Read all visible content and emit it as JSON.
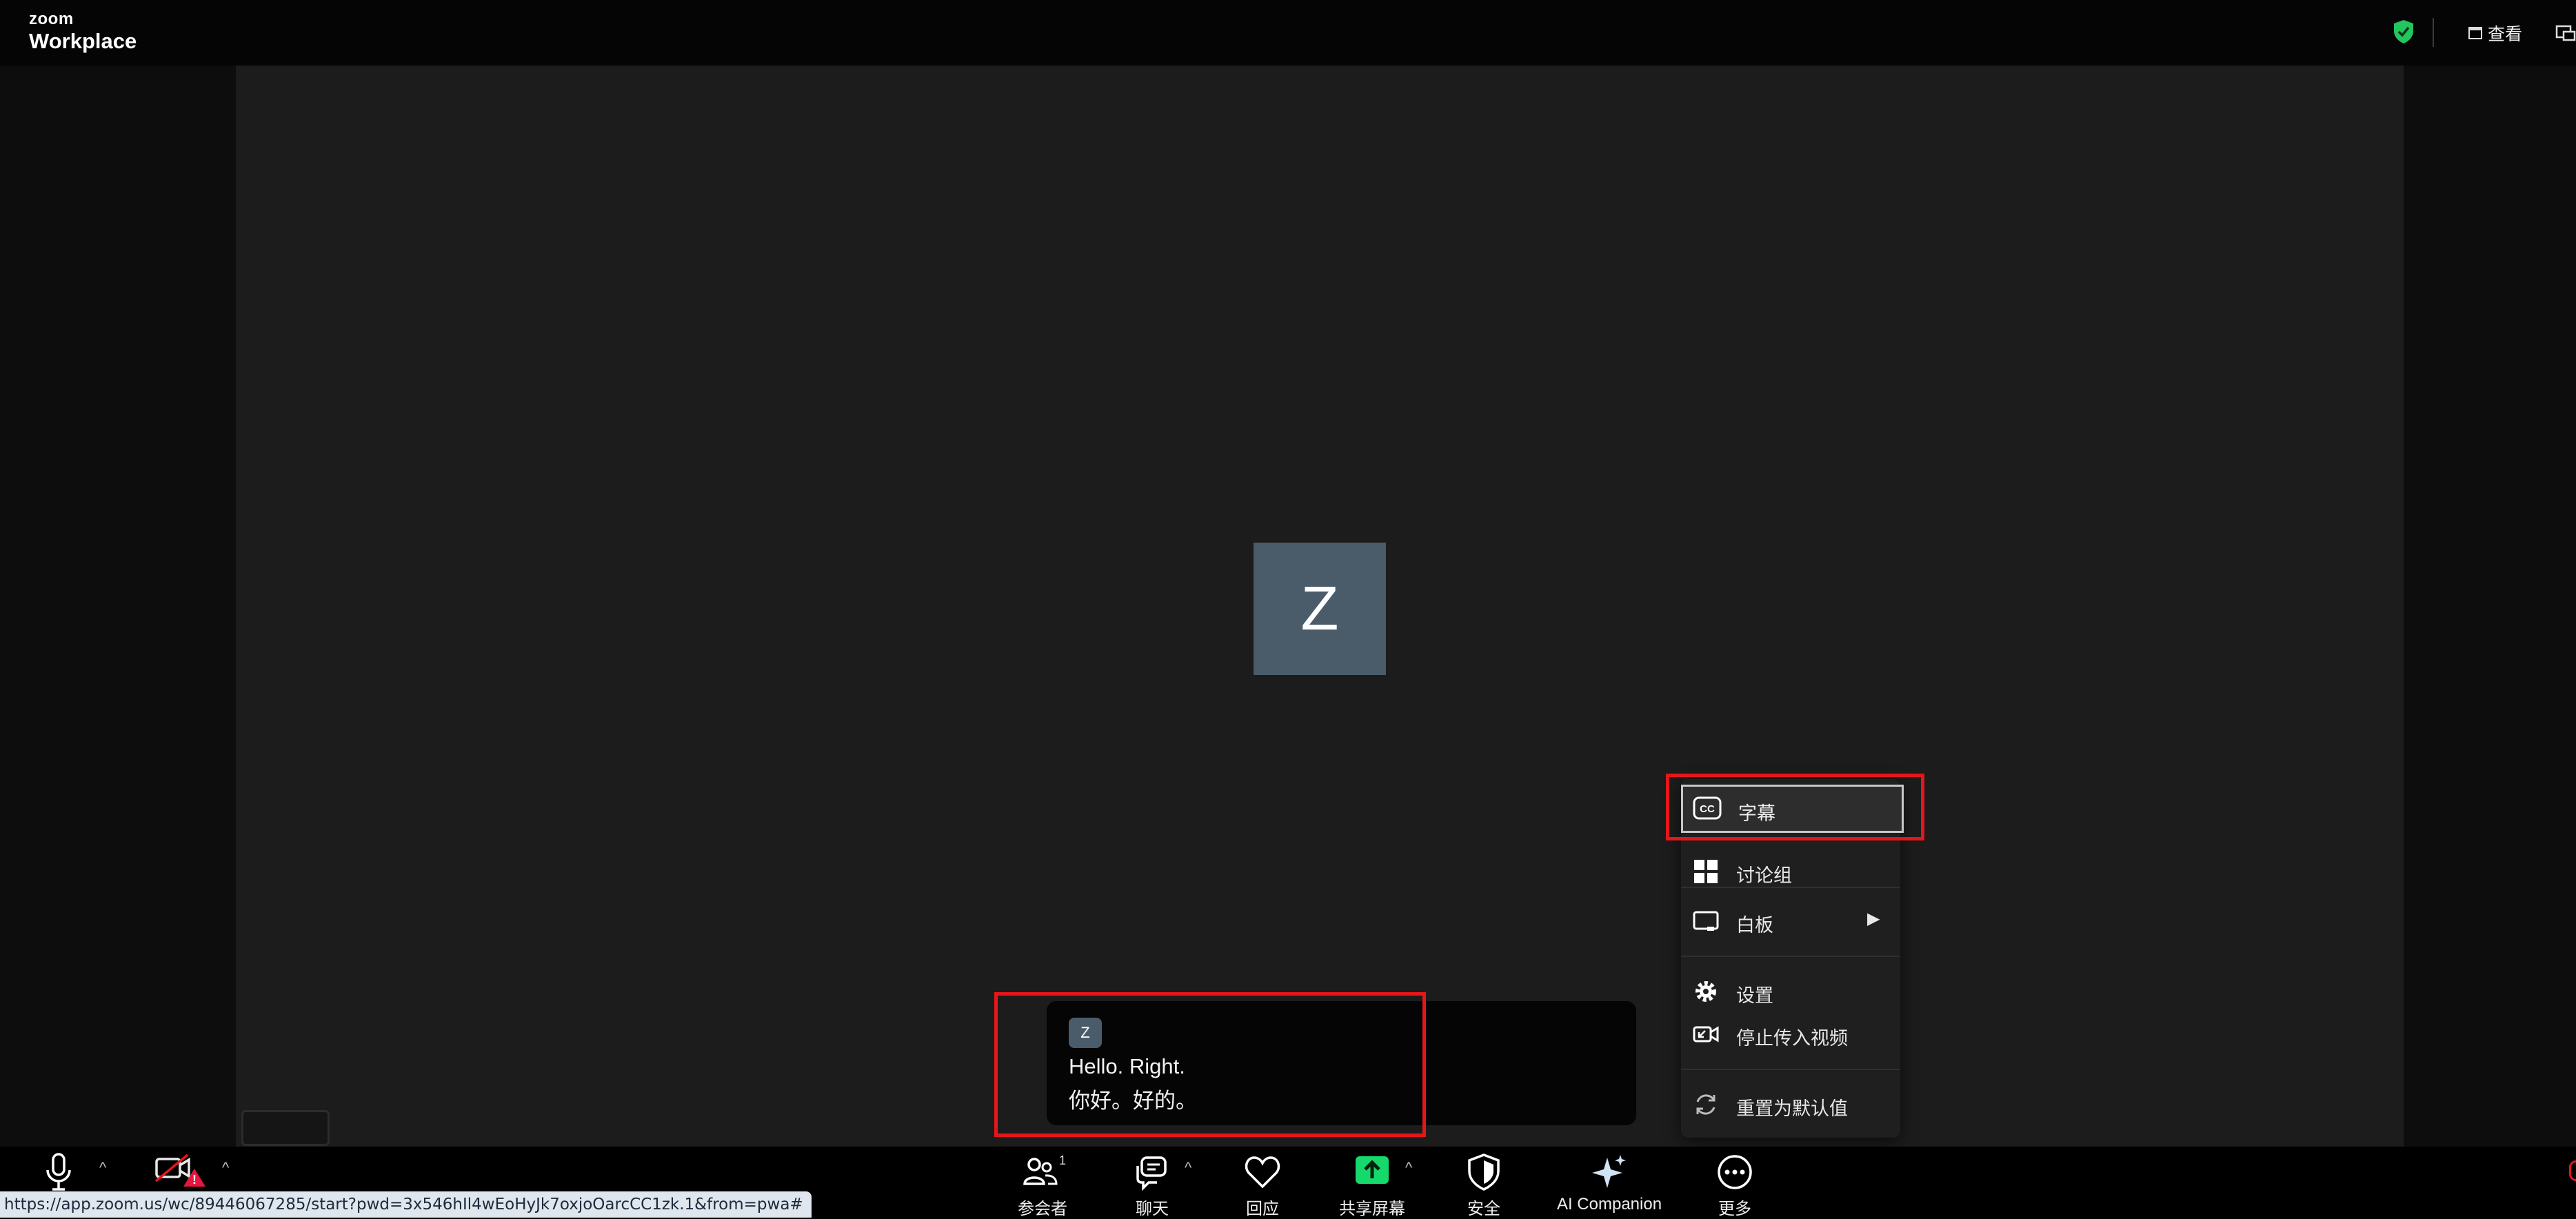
{
  "app": {
    "logo_top": "zoom",
    "logo_bottom": "Workplace"
  },
  "header": {
    "view_label": "查看"
  },
  "participant": {
    "initial": "Z"
  },
  "caption": {
    "speaker_initial": "Z",
    "line1": "Hello. Right.",
    "line2": "你好。好的。"
  },
  "more_menu": {
    "items": [
      {
        "label": "字幕",
        "icon": "closed-captions-icon"
      },
      {
        "label": "讨论组",
        "icon": "breakout-rooms-icon"
      },
      {
        "label": "白板",
        "icon": "whiteboard-icon"
      },
      {
        "label": "设置",
        "icon": "gear-icon"
      },
      {
        "label": "停止传入视频",
        "icon": "stop-incoming-video-icon"
      },
      {
        "label": "重置为默认值",
        "icon": "reset-icon"
      }
    ]
  },
  "toolbar": {
    "participants_label": "参会者",
    "participants_count": "1",
    "chat_label": "聊天",
    "reactions_label": "回应",
    "share_label": "共享屏幕",
    "security_label": "安全",
    "ai_label": "AI Companion",
    "more_label": "更多"
  },
  "status_url": "https://app.zoom.us/wc/89446067285/start?pwd=3x546hIl4wEoHyJk7oxjoOarcCC1zk.1&from=pwa#",
  "colors": {
    "highlight": "#e5161a",
    "share_green": "#16d96b",
    "shield_green": "#22c55e",
    "avatar": "#4a5c6a"
  }
}
